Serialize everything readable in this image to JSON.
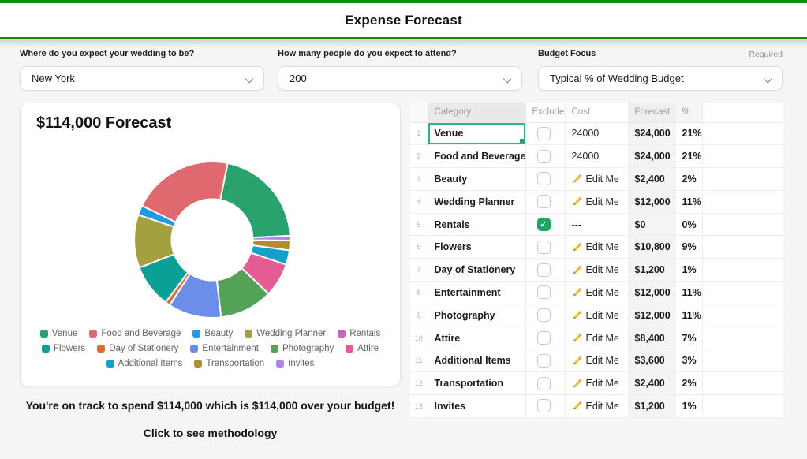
{
  "header": {
    "title": "Expense Forecast"
  },
  "form": {
    "fields": [
      {
        "label": "Where do you expect your wedding to be?",
        "value": "New York"
      },
      {
        "label": "How many people do you expect to attend?",
        "value": "200"
      },
      {
        "label": "Budget Focus",
        "value": "Typical % of Wedding Budget",
        "required": "Required"
      }
    ]
  },
  "chart_data": {
    "type": "pie",
    "subtype": "doughnut",
    "title": "$114,000 Forecast",
    "categories": [
      "Venue",
      "Food and Beverage",
      "Beauty",
      "Wedding Planner",
      "Rentals",
      "Flowers",
      "Day of Stationery",
      "Entertainment",
      "Photography",
      "Attire",
      "Additional Items",
      "Transportation",
      "Invites"
    ],
    "values": [
      24000,
      24000,
      2400,
      12000,
      0,
      10800,
      1200,
      12000,
      12000,
      8400,
      3600,
      2400,
      1200
    ],
    "percents": [
      21,
      21,
      2,
      11,
      0,
      9,
      1,
      11,
      11,
      7,
      3,
      2,
      1
    ],
    "colors": [
      "#2aa26d",
      "#e0696f",
      "#1e9ce0",
      "#a4a03d",
      "#c467b9",
      "#0aa096",
      "#d4703c",
      "#6b8fe8",
      "#53a257",
      "#e55b93",
      "#14a0ca",
      "#b18d2f",
      "#ae85e5"
    ],
    "total_label": "$114,000",
    "inner_radius_ratio": 0.52,
    "start_angle_deg": 87,
    "direction": "counterclockwise",
    "legend_position": "bottom",
    "accent_color": "#0e8b0e"
  },
  "table": {
    "headers": {
      "category": "Category",
      "exclude": "Exclude",
      "cost": "Cost",
      "forecast": "Forecast",
      "pct": "%"
    },
    "edit_label": "Edit Me",
    "rows": [
      {
        "num": "1",
        "category": "Venue",
        "excluded": false,
        "cost_type": "number",
        "cost_text": "24000",
        "forecast": "$24,000",
        "pct": "21%",
        "selected": true
      },
      {
        "num": "2",
        "category": "Food and Beverage",
        "excluded": false,
        "cost_type": "number",
        "cost_text": "24000",
        "forecast": "$24,000",
        "pct": "21%",
        "selected": false
      },
      {
        "num": "3",
        "category": "Beauty",
        "excluded": false,
        "cost_type": "edit",
        "cost_text": "Edit Me",
        "forecast": "$2,400",
        "pct": "2%",
        "selected": false
      },
      {
        "num": "4",
        "category": "Wedding Planner",
        "excluded": false,
        "cost_type": "edit",
        "cost_text": "Edit Me",
        "forecast": "$12,000",
        "pct": "11%",
        "selected": false
      },
      {
        "num": "5",
        "category": "Rentals",
        "excluded": true,
        "cost_type": "dash",
        "cost_text": "---",
        "forecast": "$0",
        "pct": "0%",
        "selected": false
      },
      {
        "num": "6",
        "category": "Flowers",
        "excluded": false,
        "cost_type": "edit",
        "cost_text": "Edit Me",
        "forecast": "$10,800",
        "pct": "9%",
        "selected": false
      },
      {
        "num": "7",
        "category": "Day of Stationery",
        "excluded": false,
        "cost_type": "edit",
        "cost_text": "Edit Me",
        "forecast": "$1,200",
        "pct": "1%",
        "selected": false
      },
      {
        "num": "8",
        "category": "Entertainment",
        "excluded": false,
        "cost_type": "edit",
        "cost_text": "Edit Me",
        "forecast": "$12,000",
        "pct": "11%",
        "selected": false
      },
      {
        "num": "9",
        "category": "Photography",
        "excluded": false,
        "cost_type": "edit",
        "cost_text": "Edit Me",
        "forecast": "$12,000",
        "pct": "11%",
        "selected": false
      },
      {
        "num": "10",
        "category": "Attire",
        "excluded": false,
        "cost_type": "edit",
        "cost_text": "Edit Me",
        "forecast": "$8,400",
        "pct": "7%",
        "selected": false
      },
      {
        "num": "11",
        "category": "Additional Items",
        "excluded": false,
        "cost_type": "edit",
        "cost_text": "Edit Me",
        "forecast": "$3,600",
        "pct": "3%",
        "selected": false
      },
      {
        "num": "12",
        "category": "Transportation",
        "excluded": false,
        "cost_type": "edit",
        "cost_text": "Edit Me",
        "forecast": "$2,400",
        "pct": "2%",
        "selected": false
      },
      {
        "num": "13",
        "category": "Invites",
        "excluded": false,
        "cost_type": "edit",
        "cost_text": "Edit Me",
        "forecast": "$1,200",
        "pct": "1%",
        "selected": false
      }
    ]
  },
  "footer": {
    "summary": "You're on track to spend $114,000 which is $114,000 over your budget!",
    "link": "Click to see methodology"
  }
}
